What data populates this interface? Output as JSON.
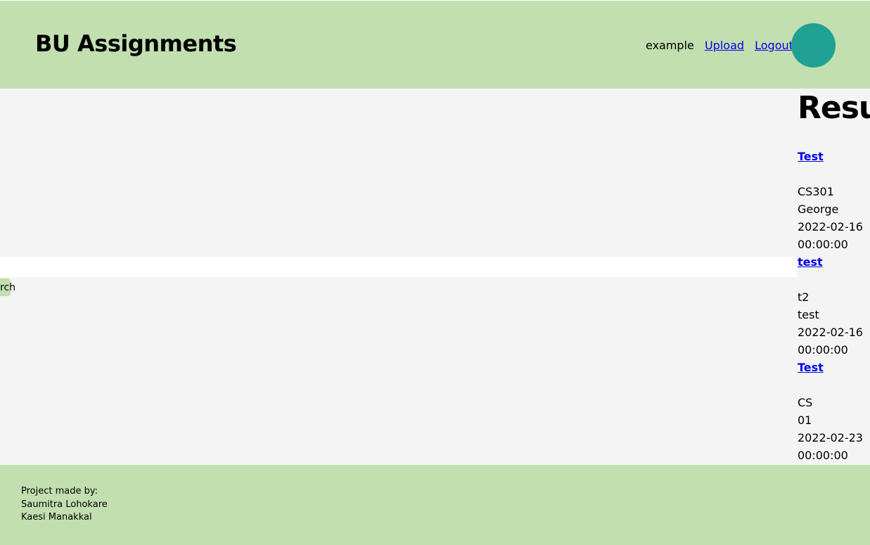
{
  "header": {
    "brand": "BU Assignments",
    "username": "example",
    "upload_label": "Upload",
    "logout_label": "Logout"
  },
  "search": {
    "value": "",
    "button_label": "Search"
  },
  "results": {
    "title": "Results",
    "items": [
      {
        "title": "Test",
        "course": "CS301",
        "author": "George",
        "date": "2022-02-16",
        "time": "00:00:00"
      },
      {
        "title": "test",
        "course": "t2",
        "author": "test",
        "date": "2022-02-16",
        "time": "00:00:00"
      },
      {
        "title": "Test",
        "course": "CS",
        "author": "01",
        "date": "2022-02-23",
        "time": "00:00:00"
      }
    ]
  },
  "footer": {
    "line1": "Project made by:",
    "line2": "Saumitra Lohokare",
    "line3": "Kaesi Manakkal"
  },
  "colors": {
    "header_bg": "#c2dfb0",
    "body_bg": "#f4f4f4",
    "avatar": "#21a094",
    "link": "#0000ee"
  }
}
